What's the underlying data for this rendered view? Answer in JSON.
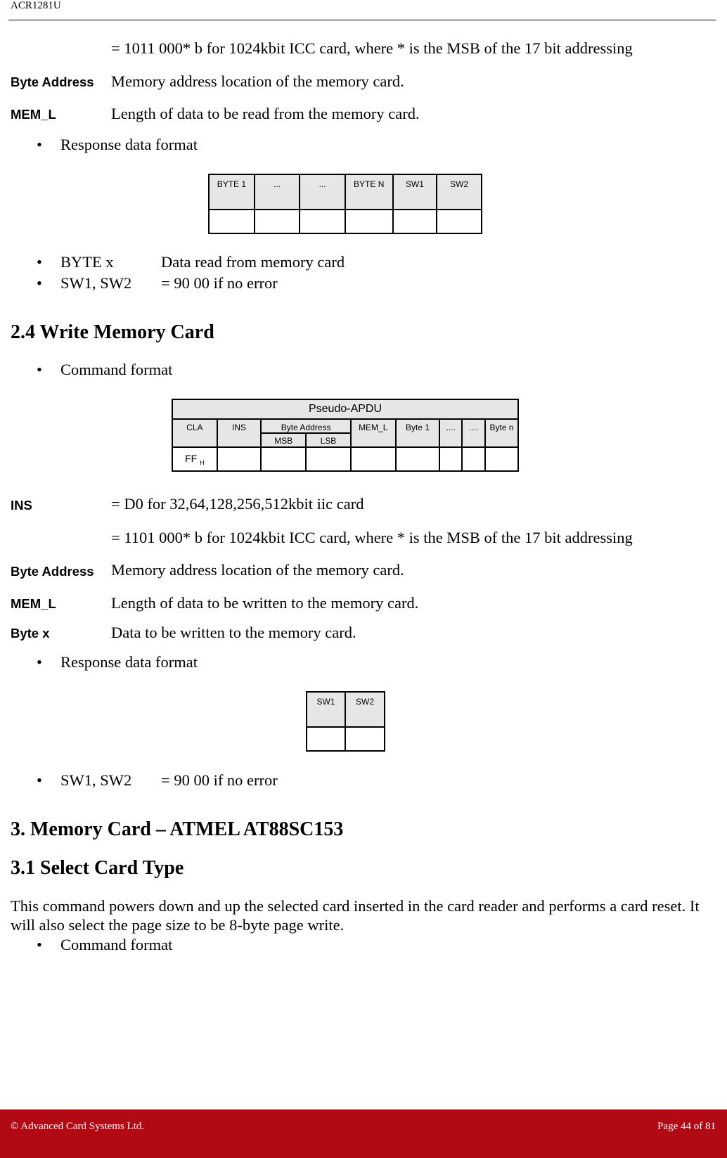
{
  "header": {
    "title": "ACR1281U"
  },
  "read_section": {
    "ins_cont": "= 1011 000* b for 1024kbit ICC card, where * is the MSB of the 17 bit addressing",
    "defs": [
      {
        "term": "Byte Address",
        "desc": "Memory address location of the memory card."
      },
      {
        "term": "MEM_L",
        "desc": "Length of data to be read from the memory card."
      }
    ],
    "response_bullet": "Response data format",
    "response_table": {
      "headers": [
        "BYTE 1",
        "...",
        "...",
        "BYTE N",
        "SW1",
        "SW2"
      ],
      "values": [
        "",
        "",
        "",
        "",
        "",
        ""
      ]
    },
    "response_items": [
      {
        "term": "BYTE x",
        "desc": "Data read from memory card"
      },
      {
        "term": "SW1, SW2",
        "desc": "= 90  00  if no error"
      }
    ]
  },
  "write_section": {
    "heading": "2.4 Write Memory Card",
    "command_bullet": "Command format",
    "command_table": {
      "title": "Pseudo-APDU",
      "headers": [
        "CLA",
        "INS",
        "Byte Address",
        "MEM_L",
        "Byte 1",
        "....",
        "....",
        "Byte n"
      ],
      "subheaders": [
        "MSB",
        "LSB"
      ],
      "values": {
        "cla": "FF",
        "cla_suffix": "H"
      }
    },
    "defs": [
      {
        "term": "INS",
        "desc": "= D0  for 32,64,128,256,512kbit iic card"
      },
      {
        "term": "",
        "desc": "= 1101 000* b for 1024kbit ICC card, where * is the MSB of the 17 bit addressing"
      },
      {
        "term": "Byte Address",
        "desc": "Memory address location of the memory card."
      },
      {
        "term": "MEM_L",
        "desc": "Length of data to be written to the memory card."
      },
      {
        "term": "Byte x",
        "desc": "Data to be written to the memory card."
      }
    ],
    "response_bullet": "Response data format",
    "response_table": {
      "headers": [
        "SW1",
        "SW2"
      ],
      "values": [
        "",
        ""
      ]
    },
    "response_items": [
      {
        "term": "SW1, SW2",
        "desc": "= 90 00  if no error"
      }
    ]
  },
  "section3": {
    "heading": "3. Memory Card – ATMEL AT88SC153",
    "sub_heading": "3.1 Select Card Type",
    "paragraph": "This command powers down and up the selected card inserted in the card reader and performs a card reset. It will also select the page size to be 8-byte page write.",
    "command_bullet": "Command format"
  },
  "footer": {
    "copyright": "© Advanced Card Systems Ltd.",
    "page": "Page 44 of 81"
  },
  "colors": {
    "footer_bg": "#b20a14",
    "table_header_bg": "#e6e6e6"
  }
}
